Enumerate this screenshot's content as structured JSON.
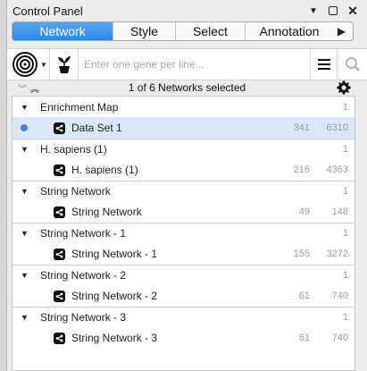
{
  "window": {
    "title": "Control Panel"
  },
  "tabs": [
    {
      "label": "Network",
      "active": true
    },
    {
      "label": "Style",
      "active": false
    },
    {
      "label": "Select",
      "active": false
    },
    {
      "label": "Annotation",
      "active": false
    }
  ],
  "toolbar": {
    "search_placeholder": "Enter one gene per line..."
  },
  "status": {
    "text": "1 of 6 Networks selected"
  },
  "colors": {
    "accent": "#2c86ea",
    "selected_row": "#dbe7f8",
    "dot": "#3b82f0"
  },
  "groups": [
    {
      "name": "Enrichment Map",
      "count": "1",
      "network": {
        "name": "Data Set 1",
        "nodes": "341",
        "edges": "6310",
        "selected": true
      }
    },
    {
      "name": "H. sapiens (1)",
      "count": "1",
      "network": {
        "name": "H. sapiens (1)",
        "nodes": "216",
        "edges": "4363",
        "selected": false
      }
    },
    {
      "name": "String Network",
      "count": "1",
      "network": {
        "name": "String Network",
        "nodes": "49",
        "edges": "148",
        "selected": false
      }
    },
    {
      "name": "String Network - 1",
      "count": "1",
      "network": {
        "name": "String Network - 1",
        "nodes": "155",
        "edges": "3272",
        "selected": false
      }
    },
    {
      "name": "String Network - 2",
      "count": "1",
      "network": {
        "name": "String Network - 2",
        "nodes": "61",
        "edges": "740",
        "selected": false
      }
    },
    {
      "name": "String Network - 3",
      "count": "1",
      "network": {
        "name": "String Network - 3",
        "nodes": "61",
        "edges": "740",
        "selected": false
      }
    }
  ]
}
